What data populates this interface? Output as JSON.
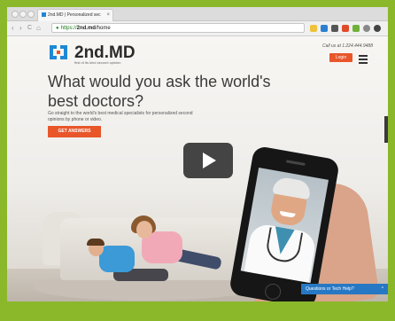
{
  "browser": {
    "tab_title": "2nd.MD | Personalized sec",
    "tab_close": "×",
    "url_scheme": "https://",
    "url_host": "2nd.md",
    "url_path": "/home",
    "back_icon": "‹",
    "forward_icon": "›",
    "reload_icon": "C",
    "home_icon": "⌂"
  },
  "header": {
    "logo_text": "2nd.MD",
    "logo_tagline": "first of its kind second opinion",
    "call_us": "Call us at 1.224.444.9488",
    "login_label": "Login"
  },
  "hero": {
    "headline": "What would you ask the world's best doctors?",
    "subcopy": "Go straight to the world's best medical specialists for personalized second opinions by phone or video.",
    "cta_label": "GET ANSWERS"
  },
  "help_widget": {
    "label": "Questions or Tech Help?",
    "caret": "^"
  },
  "colors": {
    "frame_green": "#8bb82a",
    "accent_orange": "#e8562a",
    "logo_blue": "#1e88d6",
    "help_blue": "#2778c4"
  }
}
